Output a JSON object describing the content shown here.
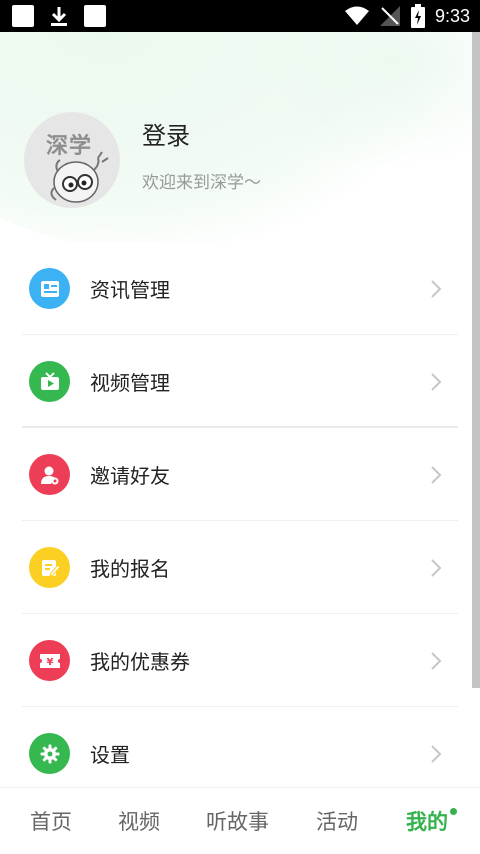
{
  "status_bar": {
    "time": "9:33",
    "icons": [
      "notification-square-icon",
      "download-icon",
      "notification-square-icon",
      "wifi-icon",
      "no-signal-icon",
      "battery-charging-icon"
    ]
  },
  "profile": {
    "avatar_text": "深学",
    "login_label": "登录",
    "welcome_text": "欢迎来到深学～"
  },
  "menu": {
    "items": [
      {
        "label": "资讯管理",
        "icon": "news-icon",
        "color": "#3cb1f3"
      },
      {
        "label": "视频管理",
        "icon": "tv-play-icon",
        "color": "#34b84f"
      },
      {
        "label": "邀请好友",
        "icon": "invite-user-icon",
        "color": "#ee3e57"
      },
      {
        "label": "我的报名",
        "icon": "edit-form-icon",
        "color": "#fbd022"
      },
      {
        "label": "我的优惠券",
        "icon": "coupon-icon",
        "color": "#ee3e57"
      },
      {
        "label": "设置",
        "icon": "gear-icon",
        "color": "#34b84f"
      }
    ]
  },
  "bottom_nav": {
    "tabs": [
      {
        "label": "首页"
      },
      {
        "label": "视频"
      },
      {
        "label": "听故事"
      },
      {
        "label": "活动"
      },
      {
        "label": "我的",
        "active": true
      }
    ],
    "active_color": "#35b24d"
  }
}
